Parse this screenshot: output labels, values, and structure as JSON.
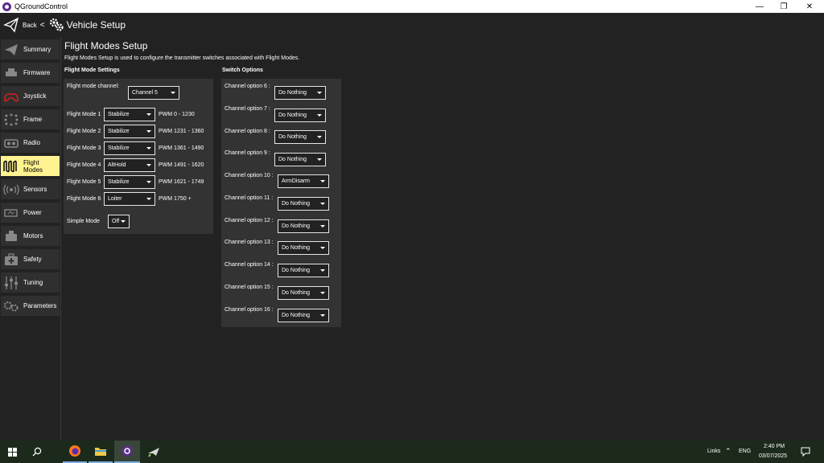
{
  "window": {
    "title": "QGroundControl"
  },
  "header": {
    "back_label": "Back",
    "separator": "<",
    "title": "Vehicle Setup"
  },
  "sidebar": {
    "items": [
      {
        "label": "Summary",
        "icon": "paper-plane-icon",
        "active": false
      },
      {
        "label": "Firmware",
        "icon": "firmware-chip-icon",
        "active": false
      },
      {
        "label": "Joystick",
        "icon": "joystick-icon",
        "active": false
      },
      {
        "label": "Frame",
        "icon": "frame-icon",
        "active": false
      },
      {
        "label": "Radio",
        "icon": "radio-icon",
        "active": false
      },
      {
        "label": "Flight Modes",
        "icon": "flight-modes-wave-icon",
        "active": true
      },
      {
        "label": "Sensors",
        "icon": "sensors-icon",
        "active": false
      },
      {
        "label": "Power",
        "icon": "power-battery-icon",
        "active": false
      },
      {
        "label": "Motors",
        "icon": "motor-icon",
        "active": false
      },
      {
        "label": "Safety",
        "icon": "safety-medkit-icon",
        "active": false
      },
      {
        "label": "Tuning",
        "icon": "tuning-sliders-icon",
        "active": false
      },
      {
        "label": "Parameters",
        "icon": "parameters-gears-icon",
        "active": false
      }
    ]
  },
  "main": {
    "title": "Flight Modes Setup",
    "description": "Flight Modes Setup is used to configure the transmitter switches associated with Flight Modes.",
    "flight_mode_settings": {
      "section_title": "Flight Mode Settings",
      "channel_label": "Flight mode channel:",
      "channel_value": "Channel 5",
      "modes": [
        {
          "label": "Flight Mode 1",
          "value": "Stabilize",
          "pwm": "PWM 0 - 1230"
        },
        {
          "label": "Flight Mode 2",
          "value": "Stabilize",
          "pwm": "PWM 1231 - 1360"
        },
        {
          "label": "Flight Mode 3",
          "value": "Stabilize",
          "pwm": "PWM 1361 - 1490"
        },
        {
          "label": "Flight Mode 4",
          "value": "AltHold",
          "pwm": "PWM 1491 - 1620"
        },
        {
          "label": "Flight Mode 5",
          "value": "Stabilize",
          "pwm": "PWM 1621 - 1749"
        },
        {
          "label": "Flight Mode 6",
          "value": "Loiter",
          "pwm": "PWM 1750 +"
        }
      ],
      "simple_mode_label": "Simple Mode",
      "simple_mode_value": "Off"
    },
    "switch_options": {
      "section_title": "Switch Options",
      "channels": [
        {
          "label": "Channel option 6 :",
          "value": "Do Nothing"
        },
        {
          "label": "Channel option 7 :",
          "value": "Do Nothing"
        },
        {
          "label": "Channel option 8 :",
          "value": "Do Nothing"
        },
        {
          "label": "Channel option 9 :",
          "value": "Do Nothing"
        },
        {
          "label": "Channel option 10 :",
          "value": "ArmDisarm"
        },
        {
          "label": "Channel option 11 :",
          "value": "Do Nothing"
        },
        {
          "label": "Channel option 12 :",
          "value": "Do Nothing"
        },
        {
          "label": "Channel option 13 :",
          "value": "Do Nothing"
        },
        {
          "label": "Channel option 14 :",
          "value": "Do Nothing"
        },
        {
          "label": "Channel option 15 :",
          "value": "Do Nothing"
        },
        {
          "label": "Channel option 16 :",
          "value": "Do Nothing"
        }
      ]
    }
  },
  "taskbar": {
    "links_label": "Links",
    "language": "ENG",
    "time": "2:40 PM",
    "date": "03/07/2025",
    "apps": [
      "firefox-icon",
      "file-explorer-icon",
      "qgroundcontrol-icon",
      "mission-planner-icon"
    ]
  },
  "colors": {
    "background": "#222222",
    "panel": "#333333",
    "active_nav": "#fff291",
    "nav_item": "#2f2f2f",
    "taskbar": "#1c2a1c"
  }
}
